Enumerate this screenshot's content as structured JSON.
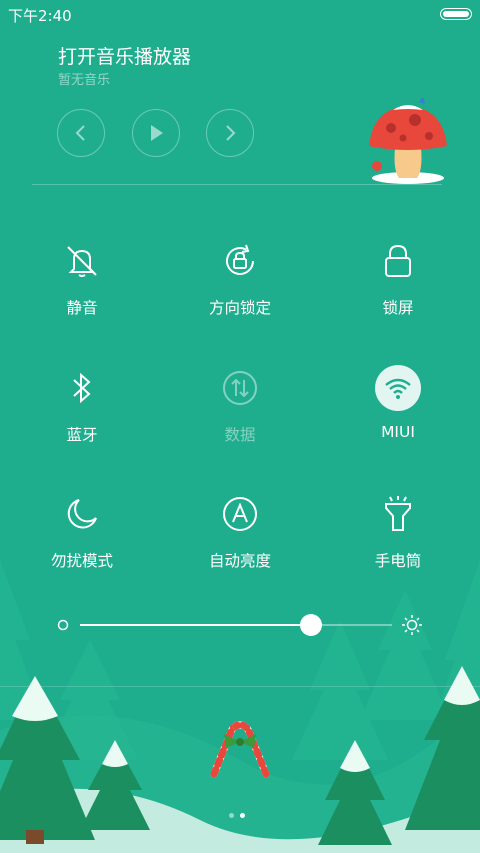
{
  "status": {
    "time": "下午2:40"
  },
  "music": {
    "title": "打开音乐播放器",
    "subtitle": "暂无音乐",
    "controls": [
      {
        "name": "previous",
        "icon": "chevron-left-icon"
      },
      {
        "name": "play",
        "icon": "play-icon"
      },
      {
        "name": "next",
        "icon": "chevron-right-icon"
      }
    ]
  },
  "toggles": [
    {
      "label": "静音",
      "icon": "bell-off-icon",
      "state": "off"
    },
    {
      "label": "方向锁定",
      "icon": "rotation-lock-icon",
      "state": "off"
    },
    {
      "label": "锁屏",
      "icon": "lock-icon",
      "state": "off"
    },
    {
      "label": "蓝牙",
      "icon": "bluetooth-icon",
      "state": "off"
    },
    {
      "label": "数据",
      "icon": "mobile-data-icon",
      "state": "disabled"
    },
    {
      "label": "MIUI",
      "icon": "wifi-icon",
      "state": "on"
    },
    {
      "label": "勿扰模式",
      "icon": "moon-icon",
      "state": "off"
    },
    {
      "label": "自动亮度",
      "icon": "auto-brightness-icon",
      "state": "off"
    },
    {
      "label": "手电筒",
      "icon": "flashlight-icon",
      "state": "off"
    }
  ],
  "brightness": {
    "level": 0.74
  },
  "pager": {
    "pages": 2,
    "current": 2
  },
  "colors": {
    "background": "#1eae8e",
    "tree": "#1a8f6e",
    "accent_active_icon": "#1eae8e"
  }
}
